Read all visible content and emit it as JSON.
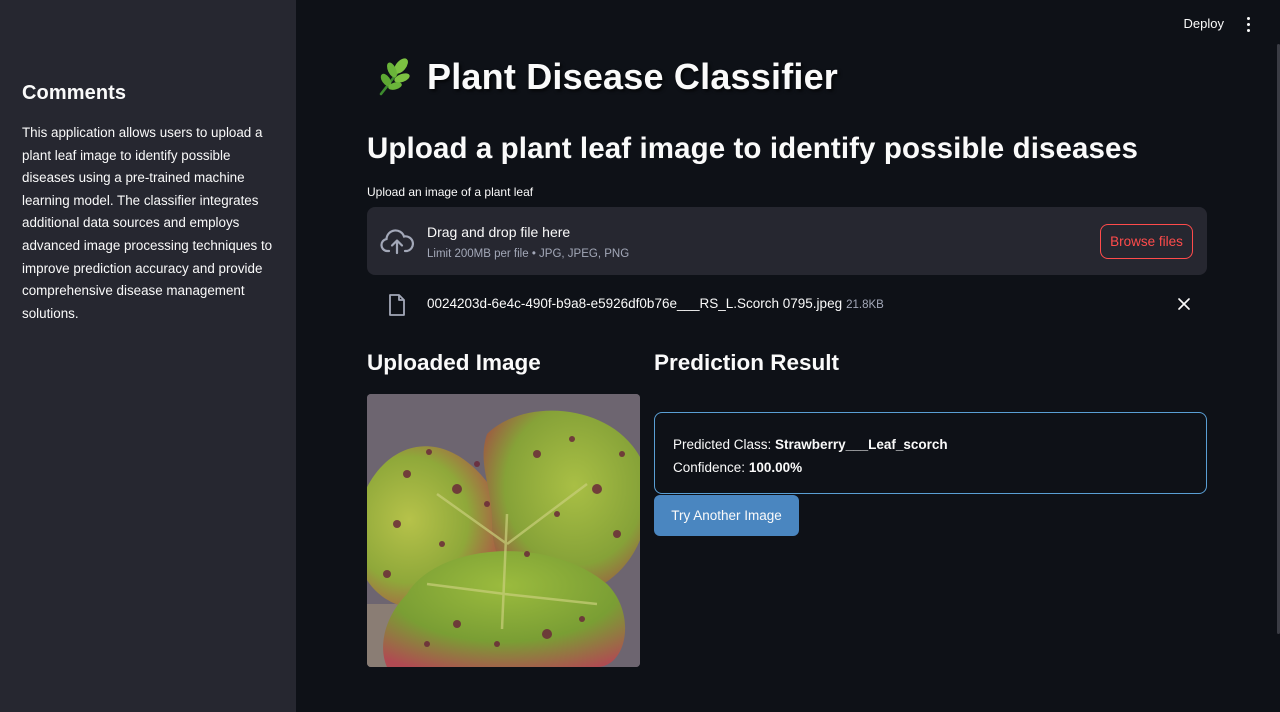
{
  "sidebar": {
    "heading": "Comments",
    "body": "This application allows users to upload a plant leaf image to identify possible diseases using a pre-trained machine learning model. The classifier integrates additional data sources and employs advanced image processing techniques to improve prediction accuracy and provide comprehensive disease management solutions."
  },
  "topbar": {
    "deploy_label": "Deploy",
    "menu_icon": "vertical-ellipsis-icon"
  },
  "main": {
    "title_icon": "herb-leaf-icon",
    "title": "Plant Disease Classifier",
    "subtitle": "Upload a plant leaf image to identify possible diseases",
    "uploader": {
      "label": "Upload an image of a plant leaf",
      "drop_title": "Drag and drop file here",
      "drop_limit": "Limit 200MB per file • JPG, JPEG, PNG",
      "browse_label": "Browse files",
      "file": {
        "name": "0024203d-6e4c-490f-b9a8-e5926df0b76e___RS_L.Scorch 0795.jpeg",
        "size": "21.8KB"
      }
    },
    "uploaded_heading": "Uploaded Image",
    "result_heading": "Prediction Result",
    "result": {
      "class_label": "Predicted Class: ",
      "class_value": "Strawberry___Leaf_scorch",
      "confidence_label": "Confidence: ",
      "confidence_value": "100.00%"
    },
    "try_again_label": "Try Another Image"
  },
  "colors": {
    "background": "#0e1117",
    "sidebar": "#262730",
    "accent_red": "#ff4b4b",
    "primary_blue": "#4a86c0",
    "result_border": "#5a9fd4"
  }
}
